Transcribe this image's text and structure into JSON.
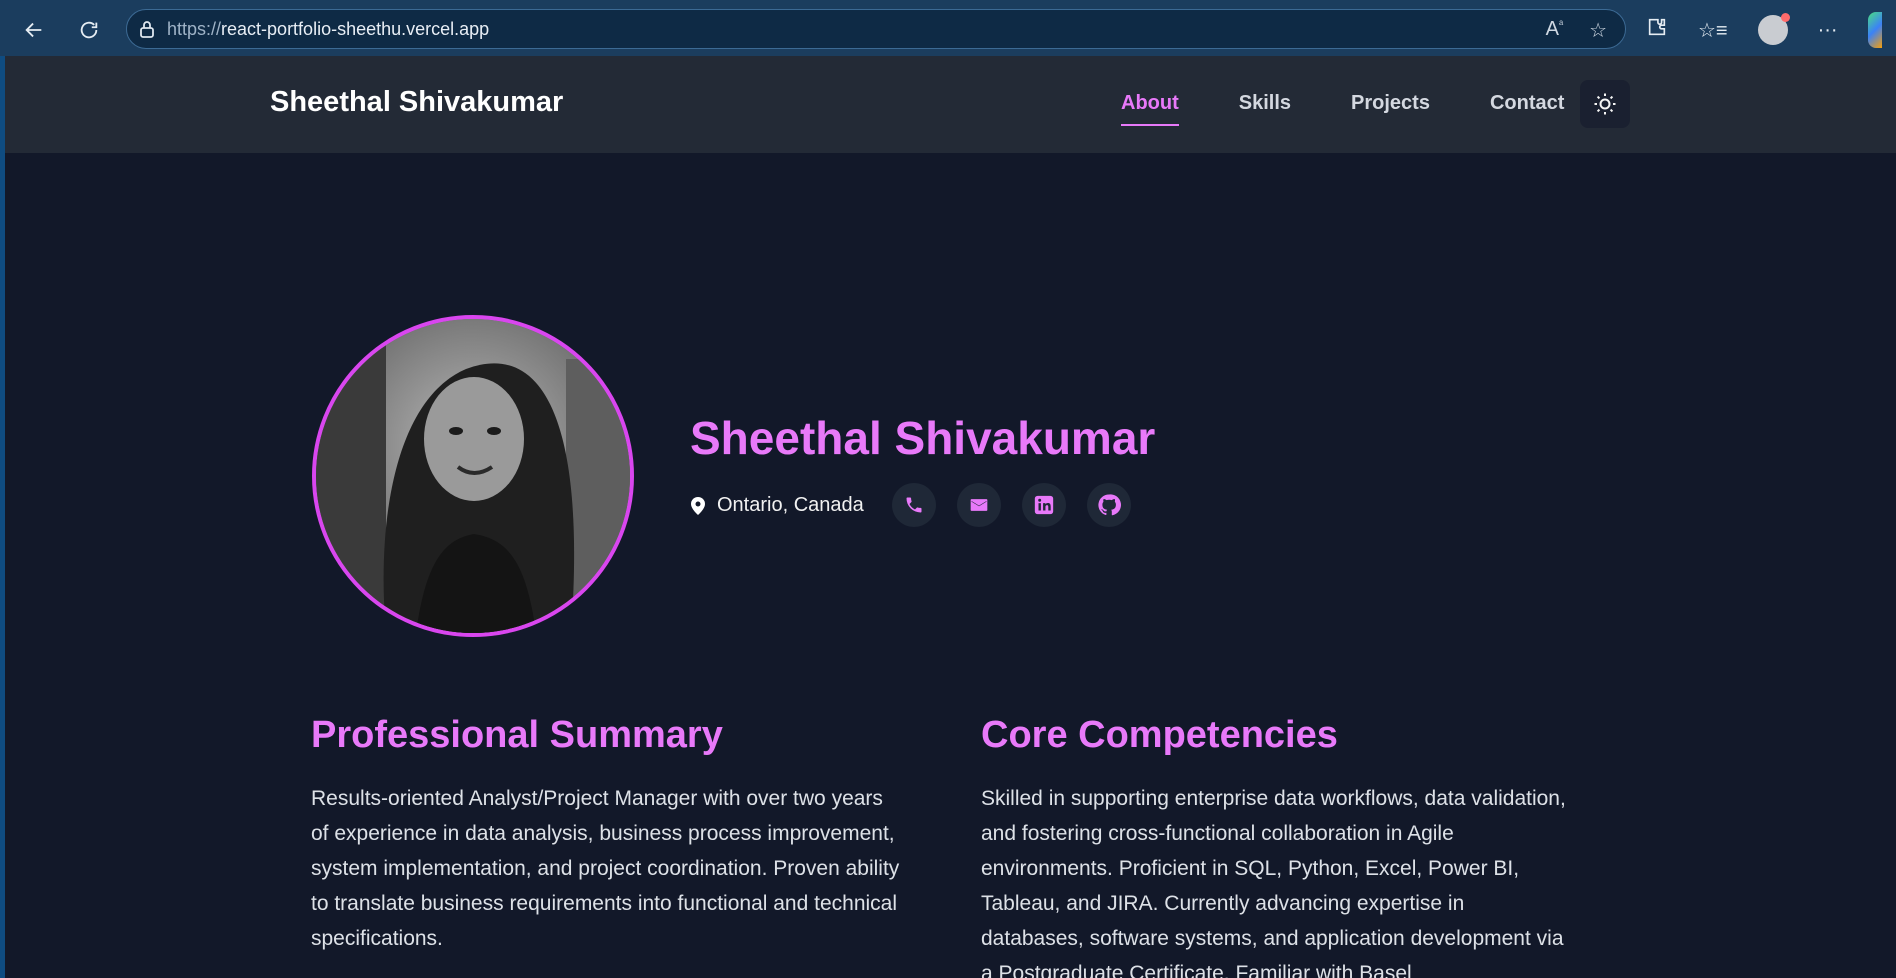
{
  "browser": {
    "url_protocol": "https://",
    "url_host": "react-portfolio-sheethu.vercel.app",
    "icons": [
      "back-icon",
      "refresh-icon",
      "lock-icon",
      "read-aloud-icon",
      "favorite-star-icon",
      "extensions-icon",
      "favorites-icon",
      "profile-icon",
      "more-icon",
      "copilot-icon"
    ]
  },
  "nav": {
    "brand": "Sheethal Shivakumar",
    "links": [
      {
        "label": "About",
        "active": true
      },
      {
        "label": "Skills",
        "active": false
      },
      {
        "label": "Projects",
        "active": false
      },
      {
        "label": "Contact",
        "active": false
      }
    ]
  },
  "hero": {
    "name": "Sheethal Shivakumar",
    "location": "Ontario, Canada",
    "socials": [
      "phone-icon",
      "email-icon",
      "linkedin-icon",
      "github-icon"
    ]
  },
  "summary": {
    "title": "Professional Summary",
    "text": "Results-oriented Analyst/Project Manager with over two years of experience in data analysis, business process improvement, system implementation, and project coordination. Proven ability to translate business requirements into functional and technical specifications."
  },
  "competencies": {
    "title": "Core Competencies",
    "text": "Skilled in supporting enterprise data workflows, data validation, and fostering cross-functional collaboration in Agile environments. Proficient in SQL, Python, Excel, Power BI, Tableau, and JIRA. Currently advancing expertise in databases, software systems, and application development via a Postgraduate Certificate. Familiar with Basel"
  },
  "colors": {
    "accent": "#e879f9",
    "page_bg": "#121829",
    "nav_bg": "#232a36"
  }
}
